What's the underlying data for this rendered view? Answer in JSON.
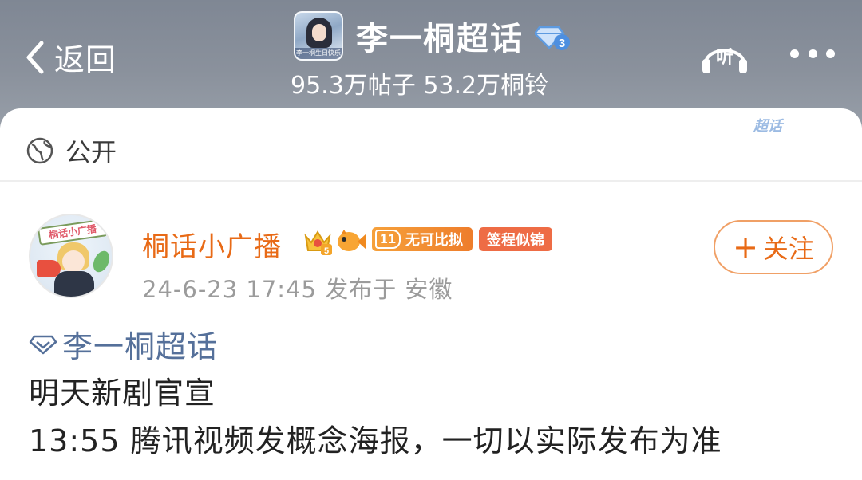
{
  "header": {
    "back_label": "返回",
    "topic_title": "李一桐超话",
    "topic_level_badge": "3",
    "topic_stats": "95.3万帖子 53.2万桐铃",
    "avatar_caption": "李一桐生日快乐",
    "listen_label": "听"
  },
  "card": {
    "watermark": "超话",
    "visibility": "公开"
  },
  "post": {
    "username": "桐话小广播",
    "avatar_sign": "桐话小广播",
    "crown_level": "5",
    "rank_level": "11",
    "rank_badge": "无可比拟",
    "sign_badge": "签程似锦",
    "timestamp": "24-6-23 17:45",
    "location": "发布于 安徽",
    "follow_plus": "+",
    "follow_label": "关注",
    "topic_link": "李一桐超话",
    "body_line1": "明天新剧官宣",
    "body_line2": "13:55 腾讯视频发概念海报，一切以实际发布为准"
  },
  "colors": {
    "header_bg": "#8a919c",
    "accent_orange": "#e86a16",
    "topic_link": "#55709a",
    "meta_gray": "#9b9b9b"
  }
}
